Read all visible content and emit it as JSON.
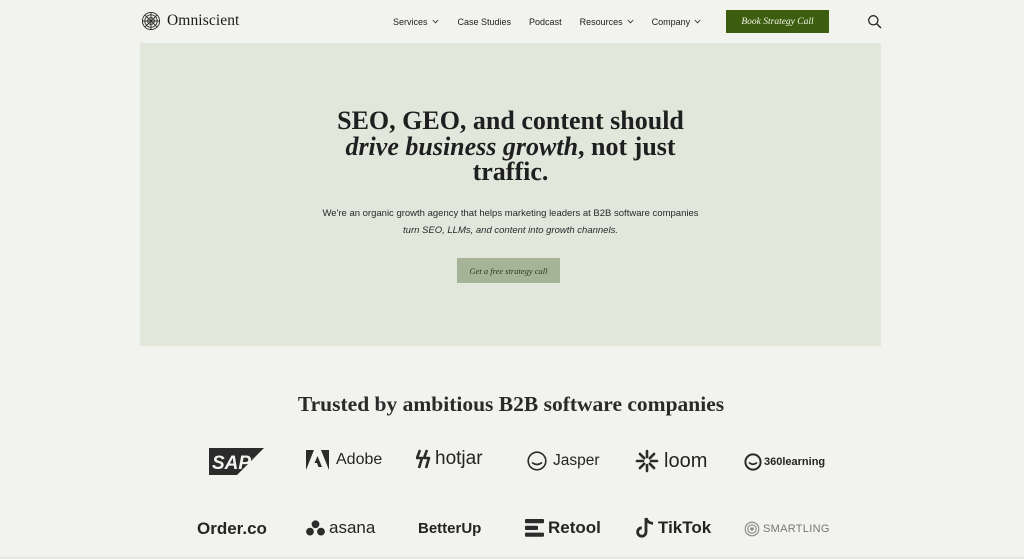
{
  "header": {
    "brand_name": "Omniscient",
    "nav": [
      {
        "label": "Services",
        "has_dropdown": true
      },
      {
        "label": "Case Studies",
        "has_dropdown": false
      },
      {
        "label": "Podcast",
        "has_dropdown": false
      },
      {
        "label": "Resources",
        "has_dropdown": true
      },
      {
        "label": "Company",
        "has_dropdown": true
      }
    ],
    "cta_label": "Book Strategy Call",
    "search_icon": "search-icon"
  },
  "hero": {
    "headline_line1": "SEO, GEO, and content should",
    "headline_emphasis": "drive business growth",
    "headline_rest": ", not just",
    "headline_line3": "traffic.",
    "subtext_line1": "We're an organic growth agency that helps marketing leaders at B2B software companies",
    "subtext_line2": "turn SEO, LLMs, and content into growth channels.",
    "cta_label": "Get a free strategy call"
  },
  "trusted": {
    "heading": "Trusted by ambitious B2B software companies",
    "row1": [
      {
        "name": "SAP"
      },
      {
        "name": "Adobe"
      },
      {
        "name": "hotjar"
      },
      {
        "name": "Jasper"
      },
      {
        "name": "loom"
      },
      {
        "name": "360learning"
      }
    ],
    "row2": [
      {
        "name": "Order.co"
      },
      {
        "name": "asana"
      },
      {
        "name": "BetterUp"
      },
      {
        "name": "Retool"
      },
      {
        "name": "TikTok"
      },
      {
        "name": "SMARTLING"
      }
    ]
  },
  "colors": {
    "page_background": "#f2f3ee",
    "hero_background": "#e2e7dc",
    "primary_cta": "#3d5e0f",
    "secondary_cta": "#a5b396"
  }
}
